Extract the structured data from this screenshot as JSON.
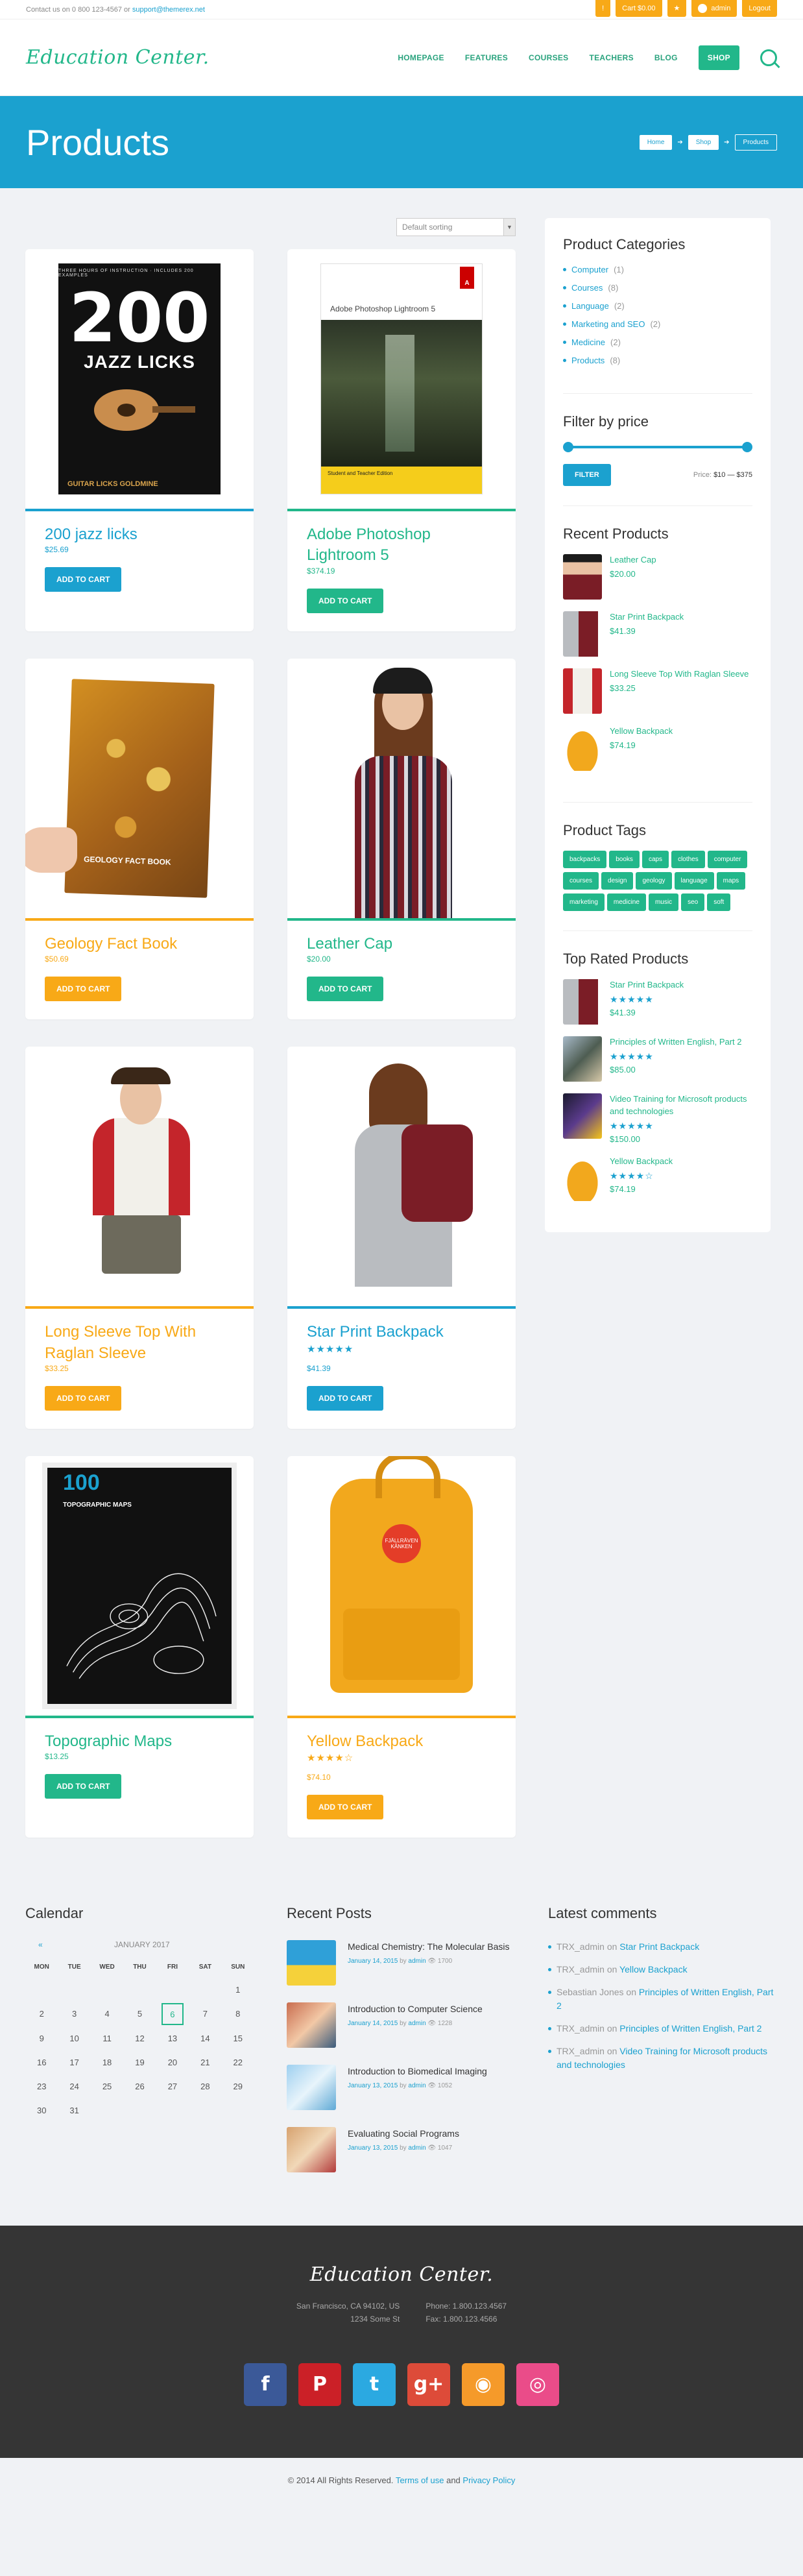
{
  "topbar": {
    "contact_prefix": "Contact us on 0 800 123-4567 or",
    "contact_email": "support@themerex.net",
    "btn_info": "!",
    "btn_cart": "Cart $0.00",
    "btn_star": "★",
    "btn_admin": "admin",
    "btn_logout": "Logout"
  },
  "header": {
    "logo": "Education Center.",
    "nav": [
      "HOMEPAGE",
      "FEATURES",
      "COURSES",
      "TEACHERS",
      "BLOG",
      "SHOP"
    ]
  },
  "title_band": {
    "title": "Products",
    "breadcrumbs": [
      "Home",
      "Shop",
      "Products"
    ]
  },
  "sorting": {
    "selected": "Default sorting"
  },
  "products": [
    {
      "title": "200 jazz licks",
      "price": "$25.69",
      "button": "ADD TO CART"
    },
    {
      "title": "Adobe Photoshop Lightroom 5",
      "price": "$374.19",
      "button": "ADD TO CART"
    },
    {
      "title": "Geology Fact Book",
      "price": "$50.69",
      "button": "ADD TO CART"
    },
    {
      "title": "Leather Cap",
      "price": "$20.00",
      "button": "ADD TO CART"
    },
    {
      "title": "Long Sleeve Top With Raglan Sleeve",
      "price": "$33.25",
      "button": "ADD TO CART"
    },
    {
      "title": "Star Print Backpack",
      "price": "$41.39",
      "stars": "★★★★★",
      "button": "ADD TO CART"
    },
    {
      "title": "Topographic Maps",
      "price": "$13.25",
      "button": "ADD TO CART"
    },
    {
      "title": "Yellow Backpack",
      "price": "$74.10",
      "stars": "★★★★☆",
      "button": "ADD TO CART"
    }
  ],
  "product_art": {
    "jazz_top": "THREE HOURS OF INSTRUCTION · INCLUDES 200 EXAMPLES",
    "jazz_num": "200",
    "jazz_sub": "JAZZ LICKS",
    "jazz_foot": "GUITAR LICKS GOLDMINE",
    "ps_title": "Adobe Photoshop Lightroom 5",
    "ps_band": "Student and Teacher Edition",
    "ps_logo": "A",
    "geology_text": "GEOLOGY FACT BOOK",
    "topo_num": "100",
    "topo_title": "TOPOGRAPHIC MAPS",
    "yb_logo": "FJÄLLRÄVEN KÅNKEN"
  },
  "sidebar": {
    "categories_title": "Product Categories",
    "categories": [
      {
        "name": "Computer",
        "count": "(1)"
      },
      {
        "name": "Courses",
        "count": "(8)"
      },
      {
        "name": "Language",
        "count": "(2)"
      },
      {
        "name": "Marketing and SEO",
        "count": "(2)"
      },
      {
        "name": "Medicine",
        "count": "(2)"
      },
      {
        "name": "Products",
        "count": "(8)"
      }
    ],
    "filter_title": "Filter by price",
    "filter_button": "FILTER",
    "price_prefix": "Price:",
    "price_range": "$10 — $375",
    "recent_title": "Recent Products",
    "recent": [
      {
        "name": "Leather Cap",
        "price": "$20.00"
      },
      {
        "name": "Star Print Backpack",
        "price": "$41.39"
      },
      {
        "name": "Long Sleeve Top With Raglan Sleeve",
        "price": "$33.25"
      },
      {
        "name": "Yellow Backpack",
        "price": "$74.19"
      }
    ],
    "tags_title": "Product Tags",
    "tags": [
      "backpacks",
      "books",
      "caps",
      "clothes",
      "computer",
      "courses",
      "design",
      "geology",
      "language",
      "maps",
      "marketing",
      "medicine",
      "music",
      "seo",
      "soft"
    ],
    "top_rated_title": "Top Rated Products",
    "top_rated": [
      {
        "name": "Star Print Backpack",
        "stars": "★★★★★",
        "price": "$41.39"
      },
      {
        "name": "Principles of Written English, Part 2",
        "stars": "★★★★★",
        "price": "$85.00"
      },
      {
        "name": "Video Training for Microsoft products and technologies",
        "stars": "★★★★★",
        "price": "$150.00"
      },
      {
        "name": "Yellow Backpack",
        "stars": "★★★★☆",
        "price": "$74.19"
      }
    ]
  },
  "calendar": {
    "title": "Calendar",
    "prev": "«",
    "month": "JANUARY 2017",
    "days": [
      "MON",
      "TUE",
      "WED",
      "THU",
      "FRI",
      "SAT",
      "SUN"
    ],
    "cells": [
      "",
      "",
      "",
      "",
      "",
      "",
      "1",
      "2",
      "3",
      "4",
      "5",
      "6",
      "7",
      "8",
      "9",
      "10",
      "11",
      "12",
      "13",
      "14",
      "15",
      "16",
      "17",
      "18",
      "19",
      "20",
      "21",
      "22",
      "23",
      "24",
      "25",
      "26",
      "27",
      "28",
      "29",
      "30",
      "31",
      "",
      "",
      "",
      "",
      ""
    ],
    "today": "6"
  },
  "recent_posts": {
    "title": "Recent Posts",
    "posts": [
      {
        "title": "Medical Chemistry: The Molecular Basis",
        "date": "January 14, 2015",
        "by": "by",
        "author": "admin",
        "views": "1700"
      },
      {
        "title": "Introduction to Computer Science",
        "date": "January 14, 2015",
        "by": "by",
        "author": "admin",
        "views": "1228"
      },
      {
        "title": "Introduction to Biomedical Imaging",
        "date": "January 13, 2015",
        "by": "by",
        "author": "admin",
        "views": "1052"
      },
      {
        "title": "Evaluating Social Programs",
        "date": "January 13, 2015",
        "by": "by",
        "author": "admin",
        "views": "1047"
      }
    ]
  },
  "latest_comments": {
    "title": "Latest comments",
    "on": "on",
    "items": [
      {
        "who": "TRX_admin",
        "link": "Star Print Backpack"
      },
      {
        "who": "TRX_admin",
        "link": "Yellow Backpack"
      },
      {
        "who": "Sebastian Jones",
        "link": "Principles of Written English, Part 2"
      },
      {
        "who": "TRX_admin",
        "link": "Principles of Written English, Part 2"
      },
      {
        "who": "TRX_admin",
        "link": "Video Training for Microsoft products and technologies"
      }
    ]
  },
  "footer": {
    "logo": "Education Center.",
    "address1": "San Francisco, CA 94102, US",
    "address2": "1234 Some St",
    "phone": "Phone: 1.800.123.4567",
    "fax": "Fax: 1.800.123.4566",
    "socials": [
      {
        "icon": "facebook-icon",
        "glyph": "f",
        "color": "#3b5998"
      },
      {
        "icon": "pinterest-icon",
        "glyph": "P",
        "color": "#cb2027"
      },
      {
        "icon": "twitter-icon",
        "glyph": "t",
        "color": "#2ba9e1"
      },
      {
        "icon": "google-plus-icon",
        "glyph": "g+",
        "color": "#dd4b39"
      },
      {
        "icon": "rss-icon",
        "glyph": "◉",
        "color": "#f59a2a"
      },
      {
        "icon": "dribbble-icon",
        "glyph": "◎",
        "color": "#ea4c89"
      }
    ],
    "copyright_prefix": "© 2014 All Rights Reserved.",
    "terms": "Terms of use",
    "and": "and",
    "privacy": "Privacy Policy"
  },
  "colors": {
    "blue": "#1ba1cf",
    "green": "#22b78a",
    "orange": "#f8a917",
    "footer": "#353535"
  }
}
